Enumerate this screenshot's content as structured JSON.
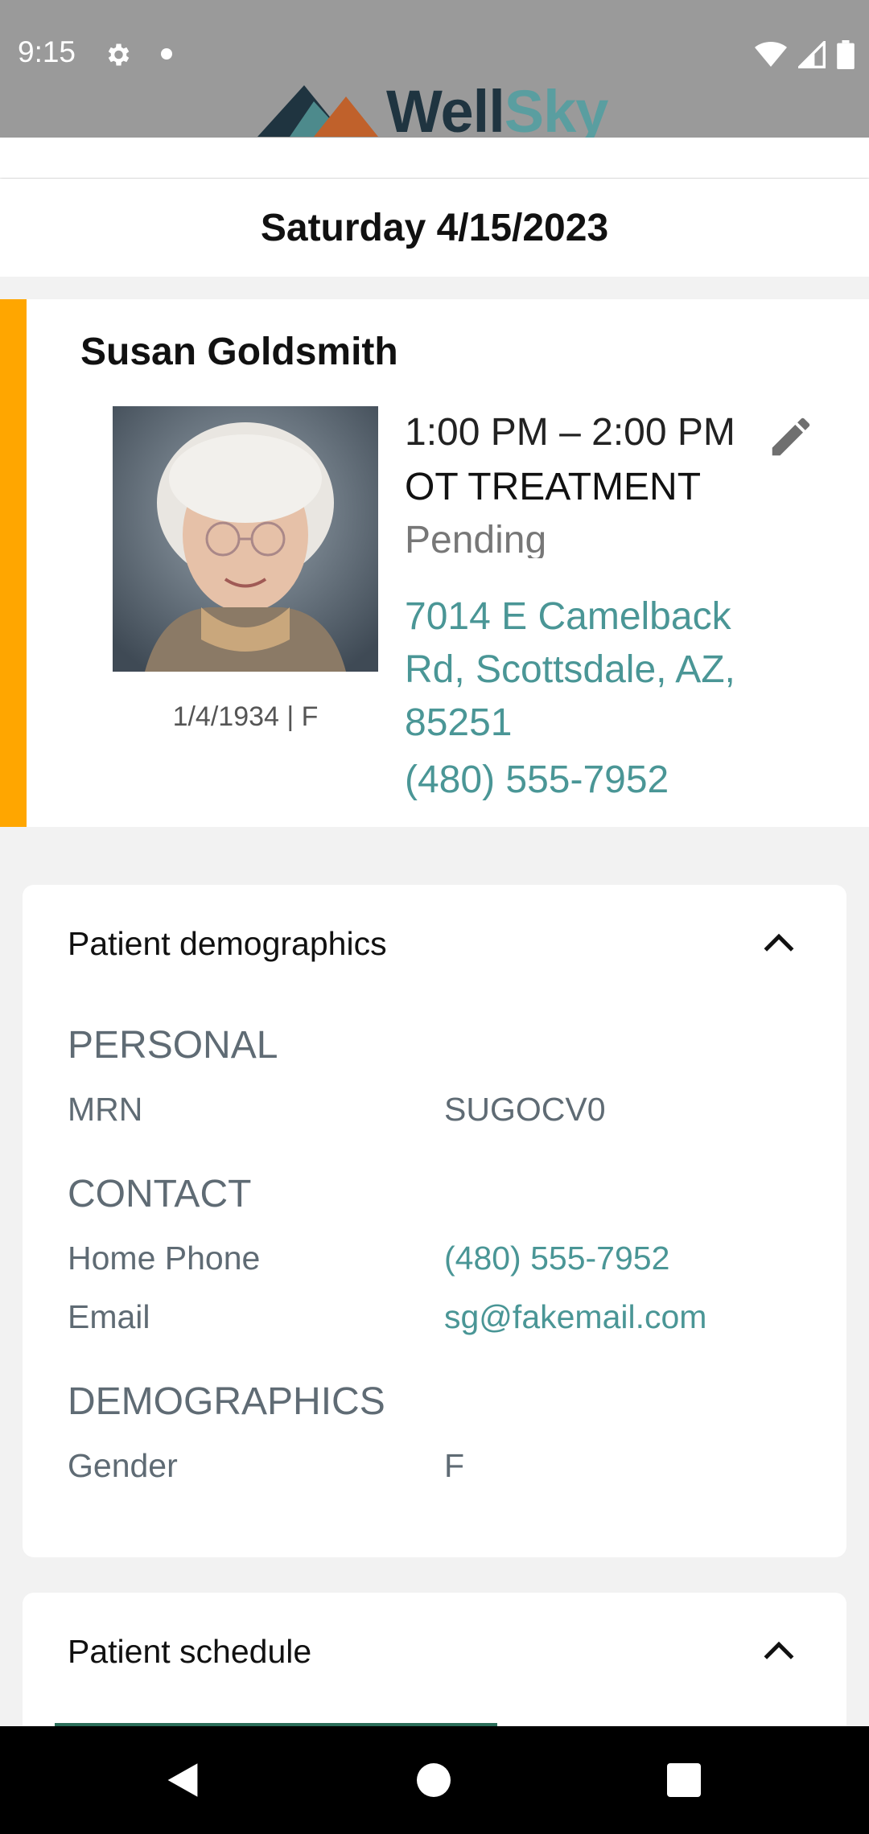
{
  "status_bar": {
    "time": "9:15"
  },
  "brand": {
    "name_part1": "Well",
    "name_part2": "Sky"
  },
  "date_header": "Saturday 4/15/2023",
  "visit": {
    "patient_name": "Susan Goldsmith",
    "patient_meta": "1/4/1934 | F",
    "time_range": "1:00 PM – 2:00 PM",
    "type": "OT TREATMENT",
    "status": "Pending",
    "address": "7014 E Camelback Rd,  Scottsdale, AZ, 85251",
    "phone": "(480) 555-7952",
    "accent_color": "#ffa600"
  },
  "demographics": {
    "title": "Patient demographics",
    "personal": {
      "heading": "PERSONAL",
      "mrn_label": "MRN",
      "mrn_value": "SUGOCV0"
    },
    "contact": {
      "heading": "CONTACT",
      "home_phone_label": "Home Phone",
      "home_phone_value": "(480) 555-7952",
      "email_label": "Email",
      "email_value": "sg@fakemail.com"
    },
    "demo": {
      "heading": "DEMOGRAPHICS",
      "gender_label": "Gender",
      "gender_value": "F"
    }
  },
  "schedule": {
    "title": "Patient schedule"
  },
  "icons": {
    "settings": "gear-icon",
    "edit": "pencil-icon",
    "collapse": "chevron-up-icon",
    "wifi": "wifi-icon",
    "signal": "signal-icon",
    "battery": "battery-icon"
  }
}
